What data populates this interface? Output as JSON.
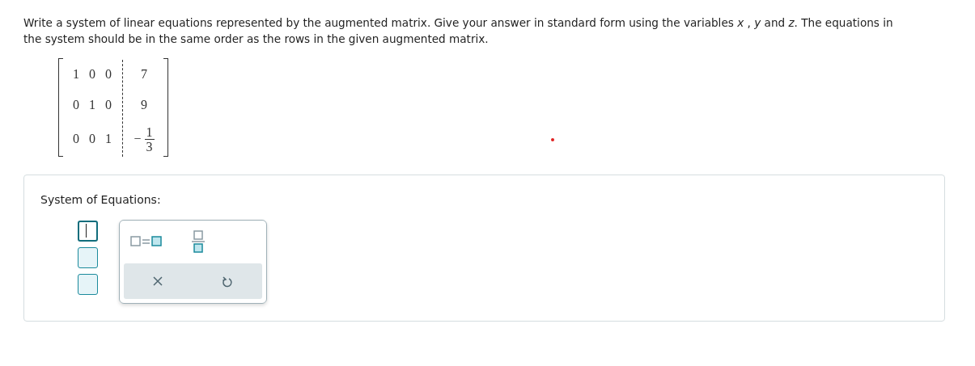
{
  "instructions": "Write a system of linear equations represented by the augmented matrix. Give your answer in standard form using the variables *x* , *y* and *z*. The equations in the system should be in the same order as the rows in the given augmented matrix.",
  "matrix": {
    "rows": [
      {
        "coefficients": [
          "1",
          "0",
          "0"
        ],
        "constant": {
          "kind": "number",
          "value": "7"
        }
      },
      {
        "coefficients": [
          "0",
          "1",
          "0"
        ],
        "constant": {
          "kind": "number",
          "value": "9"
        }
      },
      {
        "coefficients": [
          "0",
          "0",
          "1"
        ],
        "constant": {
          "kind": "fraction",
          "sign": "−",
          "numerator": "1",
          "denominator": "3"
        }
      }
    ]
  },
  "answer": {
    "label": "System of Equations:",
    "fields": [
      {
        "selected": true
      },
      {
        "selected": false
      },
      {
        "selected": false
      }
    ],
    "palette": {
      "tools": [
        {
          "kind": "equation"
        },
        {
          "kind": "fraction"
        }
      ],
      "actions": [
        {
          "kind": "clear"
        },
        {
          "kind": "undo"
        }
      ]
    }
  }
}
